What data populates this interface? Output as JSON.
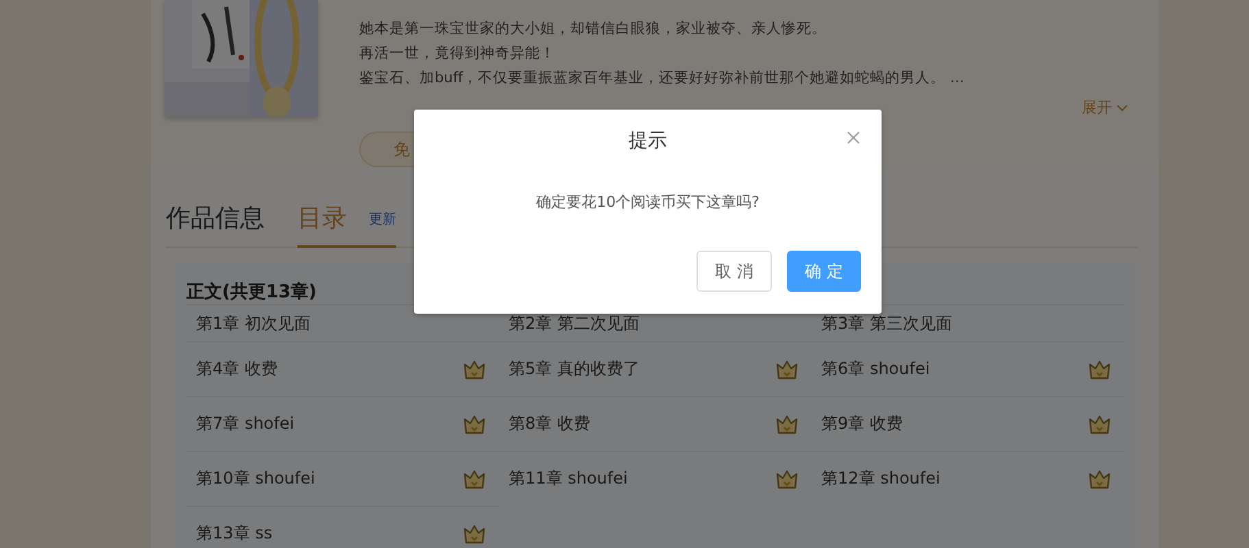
{
  "book": {
    "description": [
      "她本是第一珠宝世家的大小姐，却错信白眼狼，家业被夺、亲人惨死。",
      "再活一世，竟得到神奇异能！",
      "鉴宝石、加buff，不仅要重振蓝家百年基业，还要好好弥补前世那个她避如蛇蝎的男人。  …"
    ],
    "expand": "展开",
    "free_button": "免"
  },
  "tabs": [
    {
      "label": "作品信息",
      "selected": false
    },
    {
      "label": "目录",
      "selected": true
    }
  ],
  "update_note": "更新",
  "catalog": {
    "title": "正文(共更13章)",
    "chapters": [
      {
        "label": "第1章 初次见面",
        "paid": false
      },
      {
        "label": "第2章 第二次见面",
        "paid": false
      },
      {
        "label": "第3章 第三次见面",
        "paid": false
      },
      {
        "label": "第4章 收费",
        "paid": true
      },
      {
        "label": "第5章 真的收费了",
        "paid": true
      },
      {
        "label": "第6章 shoufei",
        "paid": true
      },
      {
        "label": "第7章 shofei",
        "paid": true
      },
      {
        "label": "第8章 收费",
        "paid": true
      },
      {
        "label": "第9章 收费",
        "paid": true
      },
      {
        "label": "第10章 shoufei",
        "paid": true
      },
      {
        "label": "第11章 shoufei",
        "paid": true
      },
      {
        "label": "第12章 shoufei",
        "paid": true
      },
      {
        "label": "第13章 ss",
        "paid": true
      }
    ]
  },
  "dialog": {
    "title": "提示",
    "message": "确定要花10个阅读币买下这章吗?",
    "buttons": [
      {
        "label": "取 消",
        "kind": "secondary"
      },
      {
        "label": "确 定",
        "kind": "primary"
      }
    ]
  }
}
